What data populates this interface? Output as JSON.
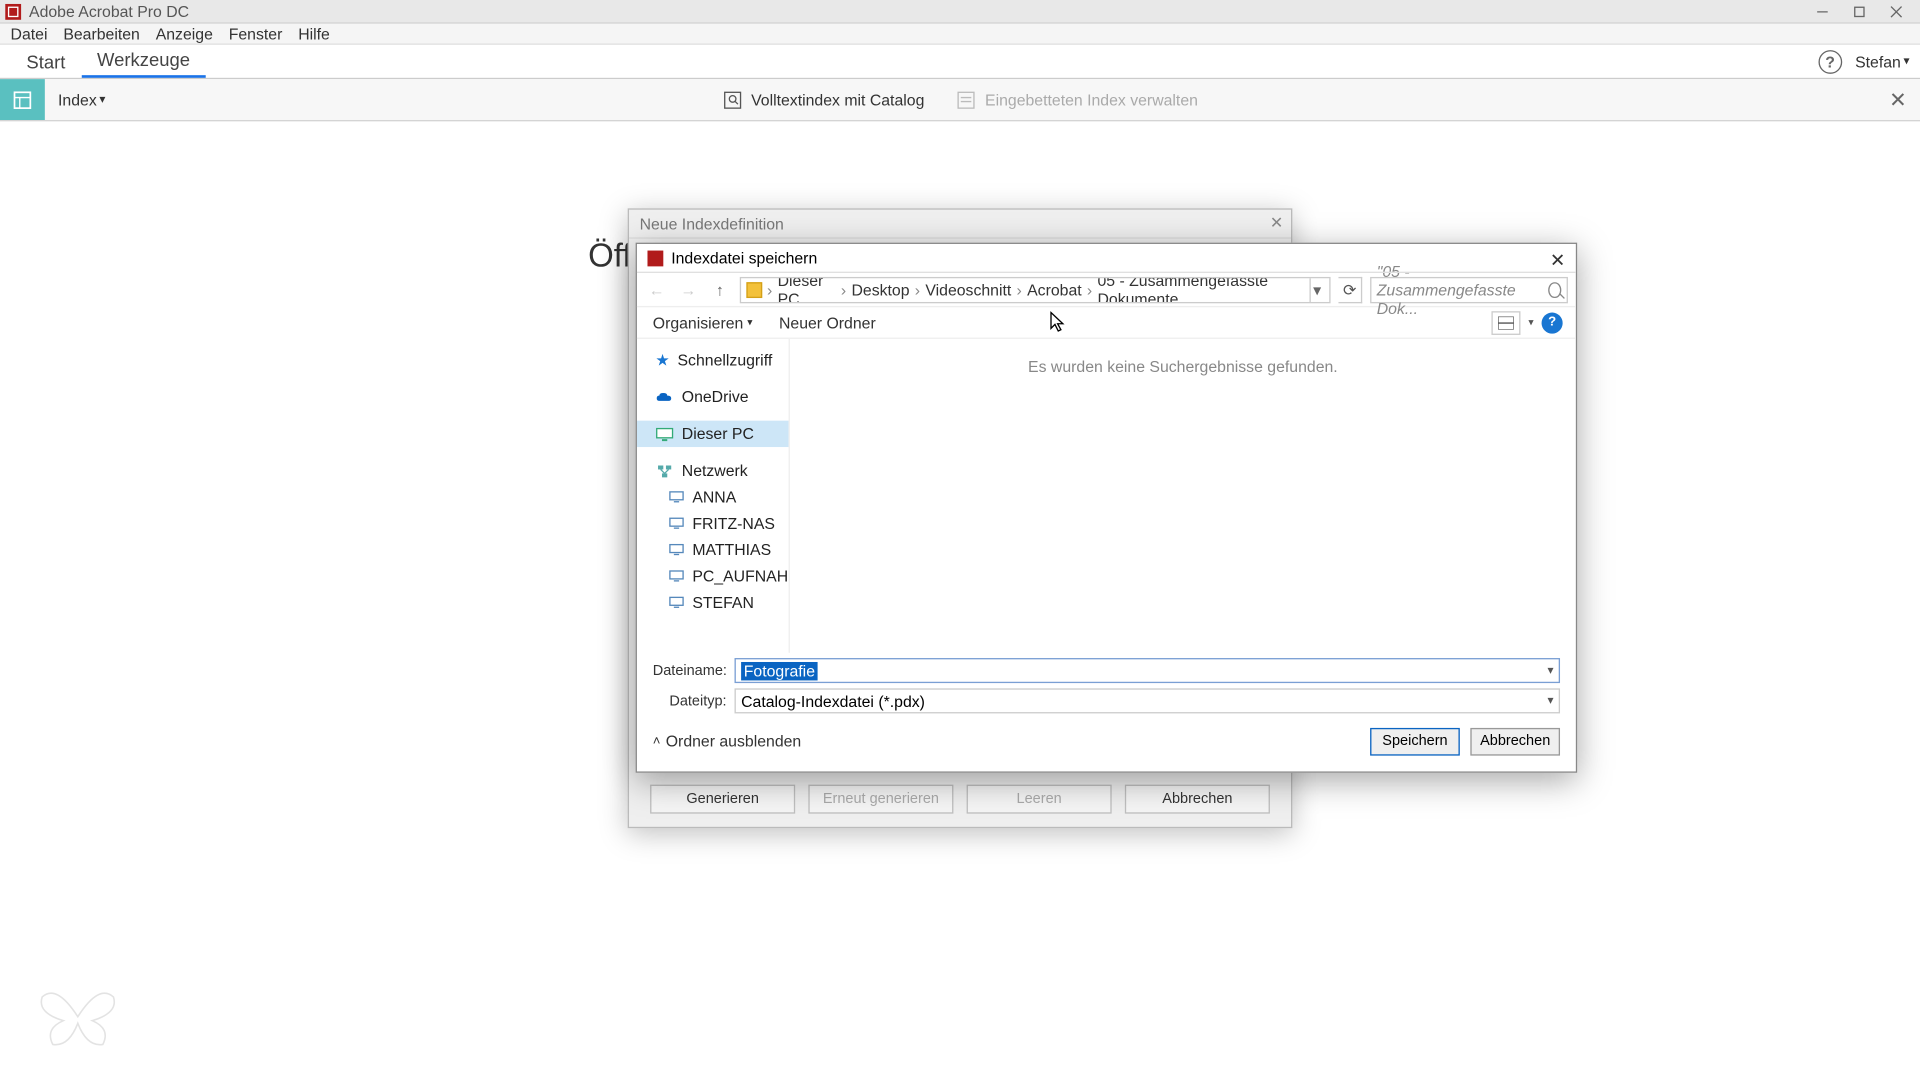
{
  "app": {
    "title": "Adobe Acrobat Pro DC"
  },
  "menubar": [
    "Datei",
    "Bearbeiten",
    "Anzeige",
    "Fenster",
    "Hilfe"
  ],
  "tabs": {
    "start": "Start",
    "tools": "Werkzeuge",
    "user": "Stefan"
  },
  "toolbar": {
    "index_label": "Index",
    "fulltext": "Volltextindex mit Catalog",
    "embedded": "Eingebetteten Index verwalten"
  },
  "bg_text": "Öff",
  "back_dialog": {
    "title": "Neue Indexdefinition",
    "buttons": {
      "generate": "Generieren",
      "regenerate": "Erneut generieren",
      "clear": "Leeren",
      "cancel": "Abbrechen"
    }
  },
  "save_dialog": {
    "title": "Indexdatei speichern",
    "breadcrumb": [
      "Dieser PC",
      "Desktop",
      "Videoschnitt",
      "Acrobat",
      "05 - Zusammengefasste Dokumente"
    ],
    "search_placeholder": "\"05 - Zusammengefasste Dok...",
    "organize": "Organisieren",
    "new_folder": "Neuer Ordner",
    "empty_msg": "Es wurden keine Suchergebnisse gefunden.",
    "tree": {
      "quick": "Schnellzugriff",
      "onedrive": "OneDrive",
      "thispc": "Dieser PC",
      "network": "Netzwerk",
      "hosts": [
        "ANNA",
        "FRITZ-NAS",
        "MATTHIAS",
        "PC_AUFNAHME",
        "STEFAN"
      ]
    },
    "filename_label": "Dateiname:",
    "filetype_label": "Dateityp:",
    "filename_value": "Fotografie",
    "filetype_value": "Catalog-Indexdatei (*.pdx)",
    "hide_folders": "Ordner ausblenden",
    "save": "Speichern",
    "cancel": "Abbrechen"
  }
}
